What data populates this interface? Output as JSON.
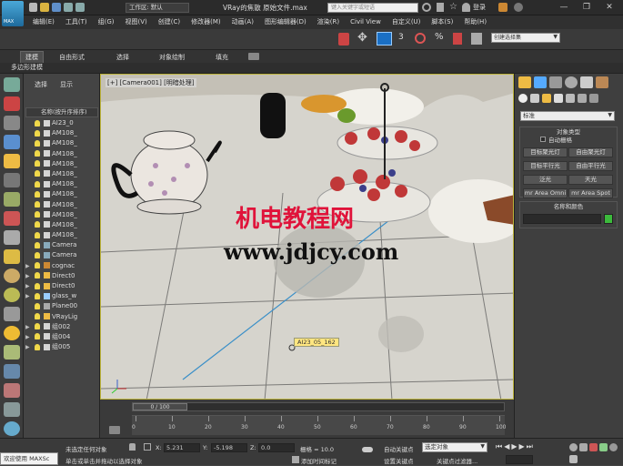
{
  "titlebar": {
    "app_badge": "MAX",
    "workspace_label": "工作区: 默认",
    "title": "VRay的焦散 原始文件.max",
    "search_placeholder": "键入关键字或短语",
    "login": "登录"
  },
  "menu": [
    "编辑(E)",
    "工具(T)",
    "组(G)",
    "视图(V)",
    "创建(C)",
    "修改器(M)",
    "动画(A)",
    "图形编辑器(D)",
    "渲染(R)",
    "Civil View",
    "自定义(U)",
    "脚本(S)",
    "帮助(H)"
  ],
  "toolbar": {
    "selection_set": "创建选择集"
  },
  "ribbon": {
    "tabs": [
      "建模",
      "自由形式",
      "选择",
      "对象绘制",
      "填充"
    ],
    "subtab": "多边形建模"
  },
  "scene_explorer": {
    "tabs": [
      "选择",
      "显示"
    ],
    "header": "名称(按升序排序)",
    "items": [
      "AI23_0",
      "AM108_",
      "AM108_",
      "AM108_",
      "AM108_",
      "AM108_",
      "AM108_",
      "AM108_",
      "AM108_",
      "AM108_",
      "AM108_",
      "AM108_",
      "Camera",
      "Camera",
      "cognac",
      "Direct0",
      "Direct0",
      "glass_w",
      "Plane00",
      "VRayLig",
      "组002",
      "组004",
      "组005"
    ]
  },
  "viewport": {
    "label": "[+] [Camera001] [明暗处理]",
    "tooltip": "AI23_05_162",
    "watermark_cn": "机电教程网",
    "watermark_url": "www.jdjcy.com"
  },
  "command_panel": {
    "dropdown": "标准",
    "rollout_type": "对象类型",
    "auto_grid": "自动栅格",
    "buttons": [
      "目标聚光灯",
      "自由聚光灯",
      "目标平行光",
      "自由平行光",
      "泛光",
      "天光",
      "mr Area Omni",
      "mr Area Spot"
    ],
    "rollout_name": "名称和颜色",
    "color": "#3cba3c"
  },
  "timeline": {
    "frame": "0 / 100",
    "ticks": [
      "0",
      "10",
      "20",
      "30",
      "40",
      "50",
      "60",
      "70",
      "80",
      "90",
      "100"
    ]
  },
  "status": {
    "welcome": "欢迎使用 MAXSc",
    "selected": "未选定任何对象",
    "hint": "单击或单击并拖动以选择对象",
    "x_label": "X:",
    "x_value": "5.231",
    "y_label": "Y:",
    "y_value": "-5.198",
    "z_label": "Z:",
    "z_value": "0.0",
    "grid": "栅格 = 10.0",
    "add_tag": "添加时间标记",
    "auto_key": "自动关键点",
    "set_key": "设置关键点",
    "key_mode": "选定对象",
    "key_filter": "关键点过滤器..."
  }
}
